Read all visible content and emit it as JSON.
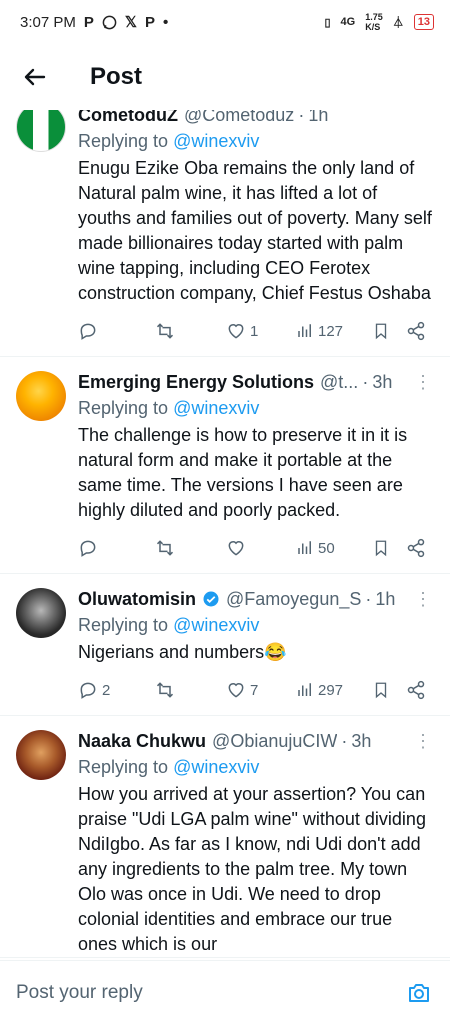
{
  "status_bar": {
    "time": "3:07 PM",
    "left_icons": [
      "P",
      "whatsapp",
      "X",
      "P",
      "•"
    ],
    "network_speed": "1.75",
    "speed_unit": "K/S",
    "network": "4G",
    "battery": "13"
  },
  "header": {
    "title": "Post"
  },
  "tweets": [
    {
      "author": "CometoduZ",
      "handle": "@Cometoduz",
      "time": "1h",
      "replying_prefix": "Replying to ",
      "replying_to": "@winexviv",
      "text": "Enugu Ezike Oba remains the only land of Natural palm wine, it has lifted a lot of youths and families out of poverty. Many self made billionaires today started with palm wine tapping, including CEO Ferotex construction company, Chief Festus Oshaba",
      "replies": "",
      "retweets": "",
      "likes": "1",
      "views": "127"
    },
    {
      "author": "Emerging Energy Solutions",
      "handle": "@t...",
      "time": "3h",
      "replying_prefix": "Replying to ",
      "replying_to": "@winexviv",
      "text": "The challenge is how to preserve it in it is natural form and make it portable at the same time. The versions I have seen are highly diluted and poorly packed.",
      "replies": "",
      "retweets": "",
      "likes": "",
      "views": "50"
    },
    {
      "author": "Oluwatomisin",
      "handle": "@Famoyegun_S",
      "time": "1h",
      "replying_prefix": "Replying to ",
      "replying_to": "@winexviv",
      "text": "Nigerians and numbers😂",
      "replies": "2",
      "retweets": "",
      "likes": "7",
      "views": "297"
    },
    {
      "author": "Naaka Chukwu",
      "handle": "@ObianujuCIW",
      "time": "3h",
      "replying_prefix": "Replying to ",
      "replying_to": "@winexviv",
      "text": "How you arrived at your assertion? You can praise \"Udi LGA palm wine\" without dividing NdiIgbo. As far as I know, ndi Udi don't add any ingredients to the palm tree. My town Olo was once in Udi. We need to drop colonial identities and embrace our true ones which is our",
      "replies": "",
      "retweets": "",
      "likes": "",
      "views": ""
    }
  ],
  "reply_bar": {
    "placeholder": "Post your reply"
  },
  "colors": {
    "link": "#1d9bf0",
    "muted": "#536471",
    "verified": "#1d9bf0"
  }
}
